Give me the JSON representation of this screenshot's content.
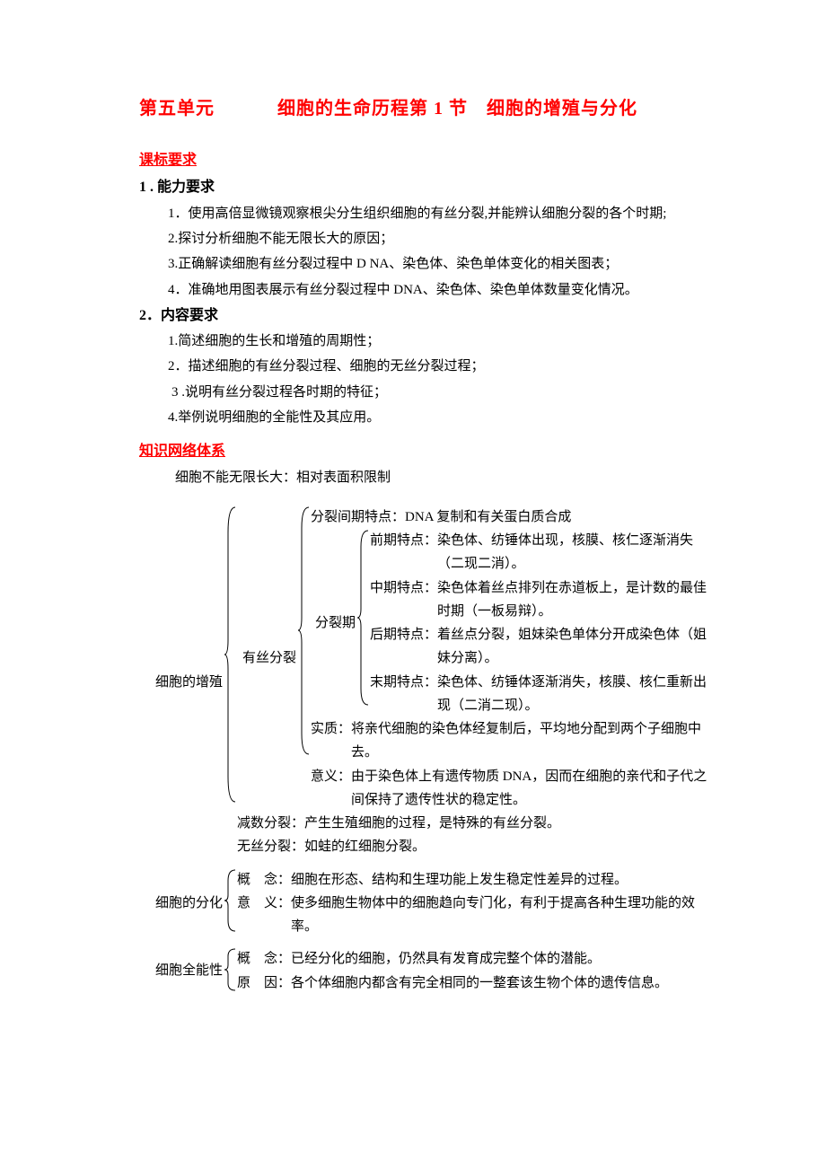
{
  "title": {
    "unit": "第五单元",
    "rest": "细胞的生命历程第 1 节　细胞的增殖与分化"
  },
  "standards": {
    "header": "课标要求",
    "ability": {
      "header": "1 . 能力要求",
      "items": [
        "1．使用高倍显微镜观察根尖分生组织细胞的有丝分裂,并能辨认细胞分裂的各个时期;",
        "2.探讨分析细胞不能无限长大的原因；",
        "3.正确解读细胞有丝分裂过程中 D NA、染色体、染色单体变化的相关图表；",
        "4．准确地用图表展示有丝分裂过程中 DNA、染色体、染色单体数量变化情况。"
      ]
    },
    "content": {
      "header": "2．内容要求",
      "items": [
        "1.简述细胞的生长和增殖的周期性；",
        "2．描述细胞的有丝分裂过程、细胞的无丝分裂过程；",
        "3 .说明有丝分裂过程各时期的特征；",
        "4.举例说明细胞的全能性及其应用。"
      ]
    }
  },
  "knowledge": {
    "header": "知识网络体系",
    "topline": "细胞不能无限长大：相对表面积限制",
    "prolif_label": "细胞的增殖",
    "mitosis_label": "有丝分裂",
    "interphase": "分裂间期特点：DNA 复制和有关蛋白质合成",
    "mphase_label": "分裂期",
    "phases": {
      "pro_lbl": "前期特点：",
      "pro_txt": "染色体、纺锤体出现，核膜、核仁逐渐消失（二现二消）。",
      "meta_lbl": "中期特点：",
      "meta_txt": "染色体着丝点排列在赤道板上，是计数的最佳时期（一板易辩）。",
      "ana_lbl": "后期特点：",
      "ana_txt": "着丝点分裂，姐妹染色单体分开成染色体（姐妹分离）。",
      "telo_lbl": "末期特点：",
      "telo_txt": "染色体、纺锤体逐渐消失，核膜、核仁重新出现（二消二现）。"
    },
    "essence_lbl": "实质：",
    "essence_txt": "将亲代细胞的染色体经复制后，平均地分配到两个子细胞中去。",
    "signif_lbl": "意义：",
    "signif_txt": "由于染色体上有遗传物质 DNA，因而在细胞的亲代和子代之间保持了遗传性状的稳定性。",
    "meiosis": "减数分裂：产生生殖细胞的过程，是特殊的有丝分裂。",
    "amitosis": "无丝分裂：如蛙的红细胞分裂。",
    "diff_label": "细胞的分化",
    "diff_concept_lbl": "概　念：",
    "diff_concept_txt": "细胞在形态、结构和生理功能上发生稳定性差异的过程。",
    "diff_sig_lbl": "意　义：",
    "diff_sig_txt": "使多细胞生物体中的细胞趋向专门化，有利于提高各种生理功能的效率。",
    "toti_label": "细胞全能性",
    "toti_concept_lbl": "概　念：",
    "toti_concept_txt": "已经分化的细胞，仍然具有发育成完整个体的潜能。",
    "toti_cause_lbl": "原　因：",
    "toti_cause_txt": "各个体细胞内都含有完全相同的一整套该生物个体的遗传信息。"
  }
}
